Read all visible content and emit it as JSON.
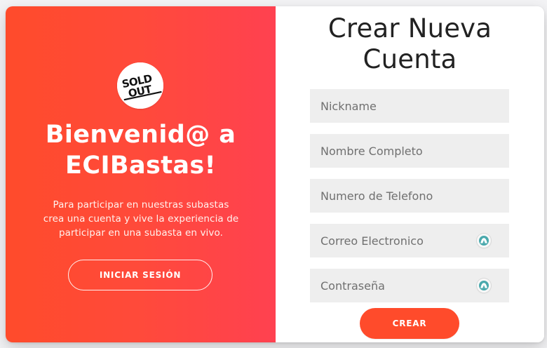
{
  "welcome": {
    "logo_text": "SOLD OUT",
    "title_line_1": "Bienvenid@ a",
    "title_line_2": "ECIBastas!",
    "copy_line_1": "Para participar en nuestras subastas",
    "copy_line_2": "crea una cuenta y vive la experiencia de",
    "copy_line_3": "participar en una subasta en vivo.",
    "login_button": "INICIAR SESIÓN"
  },
  "form": {
    "title_line_1": "Crear Nueva",
    "title_line_2": "Cuenta",
    "fields": [
      {
        "placeholder": "Nickname",
        "value": ""
      },
      {
        "placeholder": "Nombre Completo",
        "value": ""
      },
      {
        "placeholder": "Numero de Telefono",
        "value": ""
      },
      {
        "placeholder": "Correo Electronico",
        "value": "",
        "icon": "password-manager-icon"
      },
      {
        "placeholder": "Contraseña",
        "value": "",
        "icon": "password-manager-icon"
      }
    ],
    "create_button": "CREAR"
  },
  "colors": {
    "accent": "#ff4b2b",
    "gradient_end": "#ff4150",
    "field_background": "#eeeeee",
    "icon_teal": "#4aa9ad"
  }
}
